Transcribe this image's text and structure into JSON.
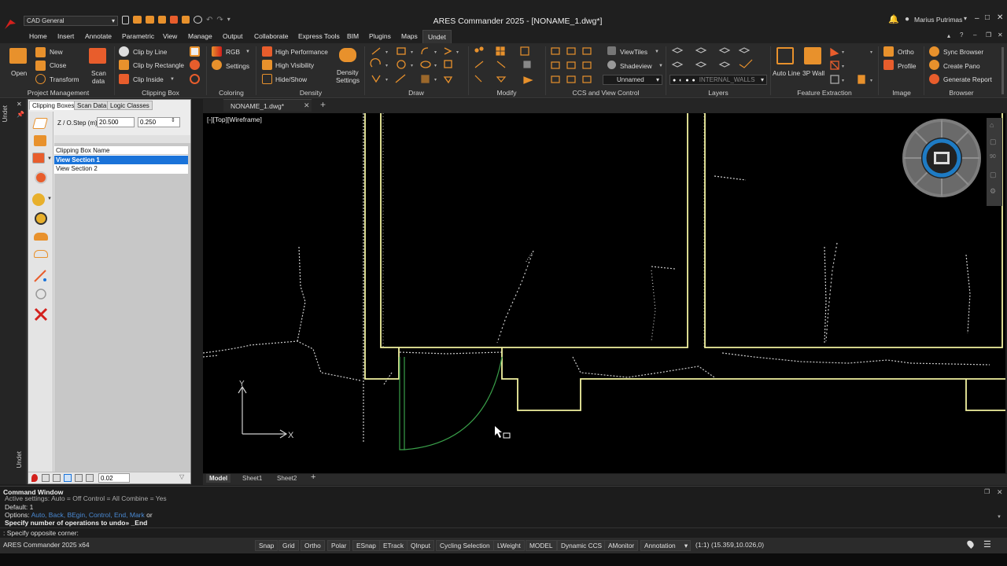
{
  "title_bar": {
    "workspace": "CAD General",
    "window_title": "ARES Commander 2025 - [NONAME_1.dwg*]",
    "user": "Marius Putrimas"
  },
  "menu_tabs": [
    "Home",
    "Insert",
    "Annotate",
    "Parametric",
    "View",
    "Manage",
    "Output",
    "Collaborate",
    "Express Tools",
    "BIM",
    "Plugins",
    "Maps",
    "Undet"
  ],
  "ribbon": {
    "project_management": {
      "open": "Open",
      "new": "New",
      "close": "Close",
      "transform": "Transform",
      "scan_data_1": "Scan",
      "scan_data_2": "data",
      "label": "Project Management"
    },
    "clipping_box": {
      "clip_by_line": "Clip by Line",
      "clip_by_rectangle": "Clip by Rectangle",
      "clip_inside": "Clip Inside",
      "label": "Clipping Box"
    },
    "coloring": {
      "rgb": "RGB",
      "settings": "Settings",
      "label": "Coloring"
    },
    "density": {
      "high_performance": "High Performance",
      "high_visibility": "High Visibility",
      "hide_show": "Hide/Show",
      "density_settings_1": "Density",
      "density_settings_2": "Settings",
      "label": "Density"
    },
    "draw": {
      "label": "Draw"
    },
    "modify": {
      "label": "Modify"
    },
    "ccs": {
      "viewtiles": "ViewTiles",
      "shadeview": "Shadeview",
      "unnamed": "Unnamed",
      "label": "CCS and View Control"
    },
    "layers": {
      "current_layer": "INTERNAL_WALLS",
      "label": "Layers"
    },
    "feature_extraction": {
      "auto_line": "Auto Line",
      "wall_3p": "3P Wall",
      "label": "Feature Extraction"
    },
    "image": {
      "ortho": "Ortho",
      "profile": "Profile",
      "label": "Image"
    },
    "browser": {
      "sync_browser": "Sync Browser",
      "create_pano": "Create Pano",
      "generate_report": "Generate Report",
      "label": "Browser"
    }
  },
  "left_strip": {
    "label_top": "Undet",
    "label_bottom": "Undet"
  },
  "panel": {
    "tabs": [
      "Clipping Boxes",
      "Scan Data",
      "Logic Classes"
    ],
    "z_step_label": "Z / O.Step (m)",
    "z_value": "20.500",
    "step_value": "0.250",
    "list_header": "Clipping Box Name",
    "list_items": [
      "View Section 1",
      "View Section 2"
    ],
    "selected_index": 0,
    "bottom_value": "0.02"
  },
  "doc_tab": "NONAME_1.dwg*",
  "viewport_label": "[-][Top][Wireframe]",
  "sheet_tabs": [
    "Model",
    "Sheet1",
    "Sheet2"
  ],
  "command_window": {
    "title": "Command Window",
    "line1": "Active settings: Auto = Off Control = All Combine = Yes",
    "line2": "Default: 1",
    "line3_prefix": "Options:",
    "line3_options": [
      "Auto,",
      "Back,",
      "BEgin,",
      "Control,",
      "End,",
      "Mark"
    ],
    "line3_suffix": "or",
    "line4": "Specify number of operations to undo» _End",
    "prompt": ": Specify opposite corner:"
  },
  "status_bar": {
    "app": "ARES Commander 2025 x64",
    "buttons": [
      "Snap",
      "Grid",
      "Ortho",
      "Polar",
      "ESnap",
      "ETrack",
      "QInput",
      "Cycling Selection",
      "LWeight",
      "MODEL",
      "Dynamic CCS",
      "AMonitor",
      "Annotation"
    ],
    "scale": "(1:1)",
    "coords": "(15.359,10.026,0)"
  },
  "colors": {
    "accent": "#1a73d9",
    "wall": "#f2f2a0",
    "door": "#3aa04a",
    "ribbon_bg": "#2b2b2b",
    "canvas": "#000000"
  }
}
